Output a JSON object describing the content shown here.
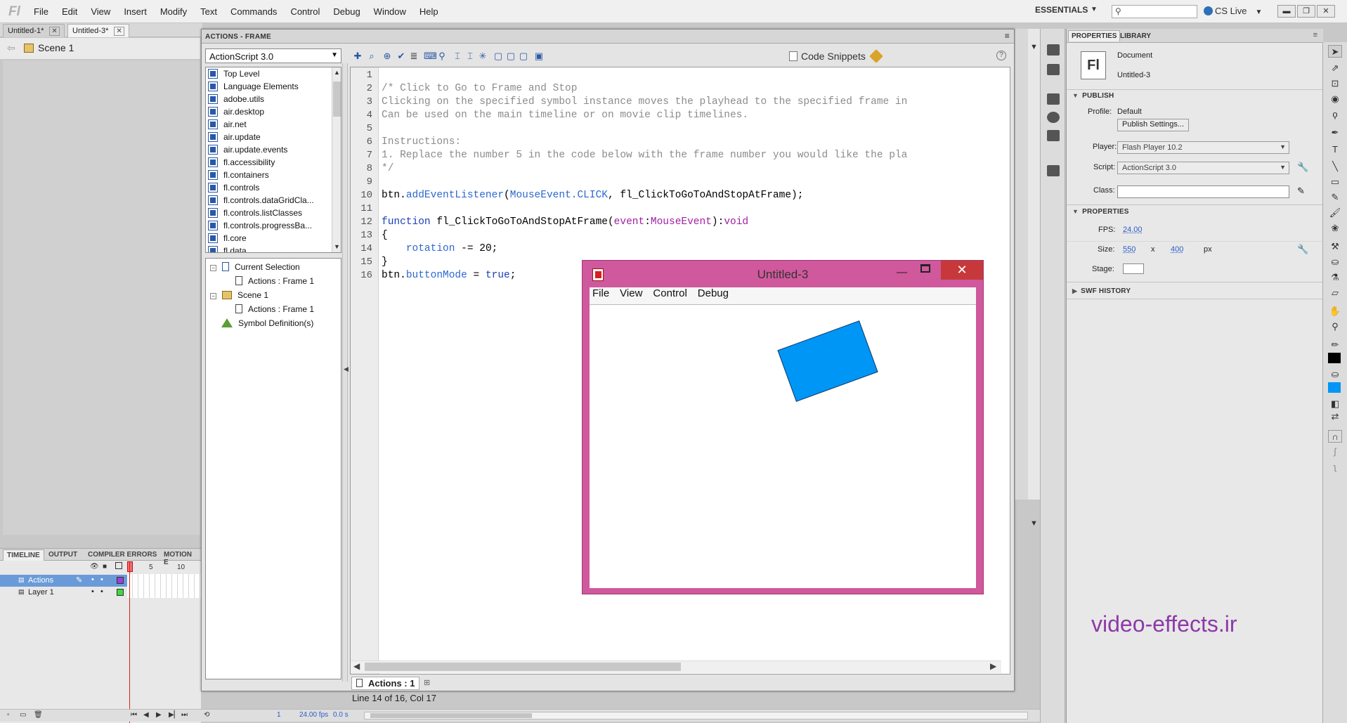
{
  "app": {
    "logo": "Fl",
    "menus": [
      "File",
      "Edit",
      "View",
      "Insert",
      "Modify",
      "Text",
      "Commands",
      "Control",
      "Debug",
      "Window",
      "Help"
    ],
    "workspace": "ESSENTIALS",
    "cs_live": "CS Live"
  },
  "document_tabs": [
    {
      "label": "Untitled-1*",
      "active": false
    },
    {
      "label": "Untitled-3*",
      "active": true
    }
  ],
  "scene": "Scene 1",
  "actions_panel": {
    "title": "ACTIONS - FRAME",
    "language": "ActionScript 3.0",
    "code_snippets": "Code Snippets",
    "toolbox_items": [
      "Top Level",
      "Language Elements",
      "adobe.utils",
      "air.desktop",
      "air.net",
      "air.update",
      "air.update.events",
      "fl.accessibility",
      "fl.containers",
      "fl.controls",
      "fl.controls.dataGridCla...",
      "fl.controls.listClasses",
      "fl.controls.progressBa...",
      "fl.core",
      "fl.data"
    ],
    "navigator": {
      "current_selection": "Current Selection",
      "actions_frame_1": "Actions : Frame 1",
      "scene_1": "Scene 1",
      "actions_frame_1b": "Actions : Frame 1",
      "symbol_definitions": "Symbol Definition(s)"
    },
    "line_numbers": [
      "1",
      "2",
      "3",
      "4",
      "5",
      "6",
      "7",
      "8",
      "9",
      "10",
      "11",
      "12",
      "13",
      "14",
      "15",
      "16"
    ],
    "code": {
      "l2": "/* Click to Go to Frame and Stop",
      "l3": "Clicking on the specified symbol instance moves the playhead to the specified frame in",
      "l4": "Can be used on the main timeline or on movie clip timelines.",
      "l6": "Instructions:",
      "l7": "1. Replace the number 5 in the code below with the frame number you would like the pla",
      "l8": "*/",
      "l10a": "btn.",
      "l10b": "addEventListener",
      "l10c": "(",
      "l10d": "MouseEvent.CLICK",
      "l10e": ", fl_ClickToGoToAndStopAtFrame);",
      "l12a": "function",
      "l12b": " fl_ClickToGoToAndStopAtFrame(",
      "l12c": "event",
      "l12d": ":",
      "l12e": "MouseEvent",
      "l12f": "):",
      "l12g": "void",
      "l13": "{",
      "l14a": "    ",
      "l14b": "rotation",
      "l14c": " -= 20;",
      "l15": "}",
      "l16a": "btn.",
      "l16b": "buttonMode",
      "l16c": " = ",
      "l16d": "true",
      "l16e": ";"
    },
    "script_tab": "Actions : 1",
    "status": "Line 14 of 16, Col 17"
  },
  "properties_panel": {
    "tabs": [
      "PROPERTIES",
      "LIBRARY"
    ],
    "doc_icon": "Fl",
    "doc_type": "Document",
    "doc_name": "Untitled-3",
    "publish_header": "PUBLISH",
    "profile_label": "Profile:",
    "profile_value": "Default",
    "publish_settings": "Publish Settings...",
    "player_label": "Player:",
    "player_value": "Flash Player 10.2",
    "script_label": "Script:",
    "script_value": "ActionScript 3.0",
    "class_label": "Class:",
    "properties_header": "PROPERTIES",
    "fps_label": "FPS:",
    "fps_value": "24.00",
    "size_label": "Size:",
    "width": "550",
    "x": "x",
    "height": "400",
    "px": "px",
    "stage_label": "Stage:",
    "swf_history": "SWF HISTORY"
  },
  "timeline": {
    "tabs": [
      "TIMELINE",
      "OUTPUT",
      "COMPILER ERRORS",
      "MOTION E"
    ],
    "frame_marks": [
      "5",
      "10"
    ],
    "layers": [
      "Actions",
      "Layer 1"
    ],
    "fps": "24.00 fps",
    "time": "0.0 s",
    "frame": "1"
  },
  "swf_window": {
    "title": "Untitled-3",
    "menus": [
      "File",
      "View",
      "Control",
      "Debug"
    ],
    "rect_color": "#0096f5"
  },
  "watermark": "video-effects.ir",
  "colors": {
    "accent": "#2c68d0",
    "layer_selected": "#6a9bd8",
    "swf_frame": "#d0589c"
  }
}
